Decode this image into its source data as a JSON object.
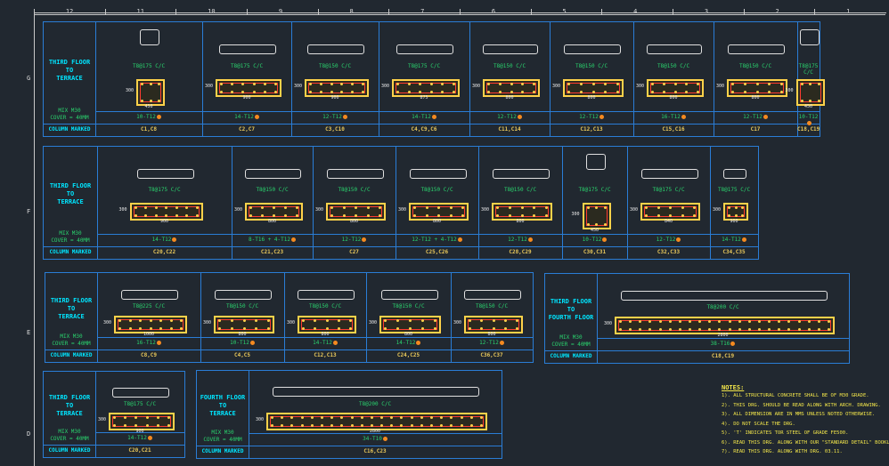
{
  "ruler_top": [
    "12",
    "11",
    "10",
    "9",
    "8",
    "7",
    "6",
    "5",
    "4",
    "3",
    "2",
    "1"
  ],
  "ruler_left": [
    "G",
    "F",
    "E",
    "D"
  ],
  "rows": [
    {
      "header": {
        "title": [
          "THIRD FLOOR",
          "TO",
          "TERRACE"
        ],
        "mix": "MIX M30",
        "cover": "COVER = 40MM"
      },
      "mark_label": "COLUMN MARKED",
      "columns": [
        {
          "spec": "T8@175 C/C",
          "dim_w": "450",
          "dim_h": "300",
          "bars": "10-T12",
          "mark": "C1,C8"
        },
        {
          "spec": "T8@175 C/C",
          "dim_w": "900",
          "dim_h": "300",
          "bars": "14-T12",
          "mark": "C2,C7"
        },
        {
          "spec": "T8@150 C/C",
          "dim_w": "900",
          "dim_h": "300",
          "bars": "12-T12",
          "mark": "C3,C10"
        },
        {
          "spec": "T8@175 C/C",
          "dim_w": "875",
          "dim_h": "300",
          "bars": "14-T12",
          "mark": "C4,C9,C6"
        },
        {
          "spec": "T8@150 C/C",
          "dim_w": "800",
          "dim_h": "300",
          "bars": "12-T12",
          "mark": "C11,C14"
        },
        {
          "spec": "T8@150 C/C",
          "dim_w": "800",
          "dim_h": "300",
          "bars": "12-T12",
          "mark": "C12,C13"
        },
        {
          "spec": "T8@150 C/C",
          "dim_w": "800",
          "dim_h": "300",
          "bars": "16-T12",
          "mark": "C15,C16"
        },
        {
          "spec": "T8@150 C/C",
          "dim_w": "800",
          "dim_h": "300",
          "bars": "12-T12",
          "mark": "C17"
        },
        {
          "spec": "T8@175 C/C",
          "dim_w": "450",
          "dim_h": "300",
          "bars": "10-T12",
          "mark": "C18,C19"
        }
      ]
    },
    {
      "header": {
        "title": [
          "THIRD FLOOR",
          "TO",
          "TERRACE"
        ],
        "mix": "MIX M30",
        "cover": "COVER = 40MM"
      },
      "mark_label": "COLUMN MARKED",
      "columns": [
        {
          "spec": "T8@175 C/C",
          "dim_w": "900",
          "dim_h": "300",
          "bars": "14-T12",
          "mark": "C20,C22"
        },
        {
          "spec": "T8@150 C/C",
          "dim_w": "800",
          "dim_h": "300",
          "bars": "8-T16 + 4-T12",
          "mark": "C21,C23"
        },
        {
          "spec": "T8@150 C/C",
          "dim_w": "800",
          "dim_h": "300",
          "bars": "12-T12",
          "mark": "C27"
        },
        {
          "spec": "T8@150 C/C",
          "dim_w": "800",
          "dim_h": "300",
          "bars": "12-T12 + 4-T12",
          "mark": "C25,C26"
        },
        {
          "spec": "T8@150 C/C",
          "dim_w": "800",
          "dim_h": "300",
          "bars": "12-T12",
          "mark": "C28,C29"
        },
        {
          "spec": "T8@175 C/C",
          "dim_w": "450",
          "dim_h": "300",
          "bars": "10-T12",
          "mark": "C30,C31"
        },
        {
          "spec": "T8@175 C/C",
          "dim_w": "840",
          "dim_h": "300",
          "bars": "12-T12",
          "mark": "C32,C33"
        },
        {
          "spec": "T8@175 C/C",
          "dim_w": "900",
          "dim_h": "300",
          "bars": "14-T12",
          "mark": "C34,C35"
        }
      ]
    },
    {
      "header": {
        "title": [
          "THIRD FLOOR",
          "TO",
          "TERRACE"
        ],
        "mix": "MIX M30",
        "cover": "COVER = 40MM"
      },
      "mark_label": "COLUMN MARKED",
      "columns": [
        {
          "spec": "T8@225 C/C",
          "dim_w": "1000",
          "dim_h": "300",
          "bars": "16-T12",
          "mark": "C8,C9"
        },
        {
          "spec": "T8@150 C/C",
          "dim_w": "800",
          "dim_h": "300",
          "bars": "10-T12",
          "mark": "C4,C5"
        },
        {
          "spec": "T8@150 C/C",
          "dim_w": "800",
          "dim_h": "300",
          "bars": "14-T12",
          "mark": "C12,C13"
        },
        {
          "spec": "T8@150 C/C",
          "dim_w": "800",
          "dim_h": "300",
          "bars": "14-T12",
          "mark": "C24,C25"
        },
        {
          "spec": "T8@150 C/C",
          "dim_w": "800",
          "dim_h": "300",
          "bars": "12-T12",
          "mark": "C36,C37"
        }
      ]
    },
    {
      "header": {
        "title": [
          "THIRD FLOOR",
          "TO",
          "FOURTH FLOOR"
        ],
        "mix": "MIX M30",
        "cover": "COVER = 40MM"
      },
      "mark_label": "COLUMN MARKED",
      "columns": [
        {
          "spec": "T8@200 C/C",
          "dim_w": "2800",
          "dim_h": "300",
          "bars": "38-T16",
          "mark": "C18,C19"
        }
      ]
    },
    {
      "header": {
        "title": [
          "THIRD FLOOR",
          "TO",
          "TERRACE"
        ],
        "mix": "MIX M30",
        "cover": "COVER = 40MM"
      },
      "mark_label": "COLUMN MARKED",
      "columns": [
        {
          "spec": "T8@175 C/C",
          "dim_w": "900",
          "dim_h": "300",
          "bars": "14-T12",
          "mark": "C20,C21"
        }
      ]
    },
    {
      "header": {
        "title": [
          "FOURTH FLOOR",
          "TO",
          "TERRACE"
        ],
        "mix": "MIX M30",
        "cover": "COVER = 40MM"
      },
      "mark_label": "COLUMN MARKED",
      "columns": [
        {
          "spec": "T8@200 C/C",
          "dim_w": "2800",
          "dim_h": "300",
          "bars": "34-T10",
          "mark": "C16,C23"
        }
      ]
    }
  ],
  "notes": {
    "heading": "NOTES:",
    "lines": [
      "1). ALL STRUCTURAL CONCRETE SHALL BE OF M30 GRADE.",
      "2). THIS DRG. SHOULD BE READ ALONG WITH ARCH. DRAWING.",
      "3). ALL DIMENSION ARE IN MMS UNLESS NOTED OTHERWISE.",
      "4). DO NOT SCALE THE DRG.",
      "5). 'T' INDICATES TOR STEEL OF GRADE FE500.",
      "6). READ THIS DRG. ALONG WITH OUR \"STANDARD DETAIL\" BOOKLET.",
      "7). READ THIS DRG. ALONG WITH DRG. 03.11."
    ]
  },
  "colors": {
    "grid": "#2a7dd6",
    "section": "#ffd24a",
    "stirrup": "#ff3b30",
    "text_cyan": "#00e5ff",
    "text_green": "#2ad46e",
    "notes": "#f3e64a"
  }
}
